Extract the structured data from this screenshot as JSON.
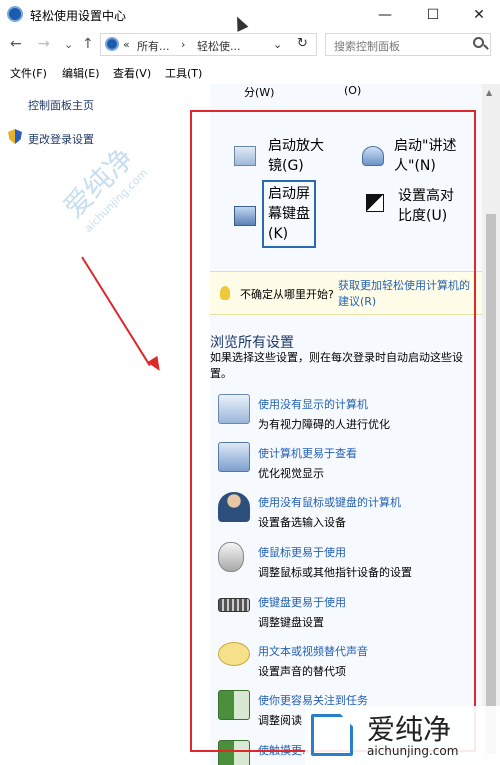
{
  "window": {
    "title": "轻松使用设置中心",
    "minimize": "—",
    "maximize": "☐",
    "close": "✕"
  },
  "nav": {
    "back": "←",
    "forward": "→",
    "recent": "⌄",
    "up": "↑",
    "breadcrumb_prefix": "«",
    "breadcrumb_1": "所有...",
    "breadcrumb_sep": "›",
    "breadcrumb_2": "轻松使...",
    "dropdown": "⌄",
    "refresh": "↻",
    "search_placeholder": "搜索控制面板"
  },
  "menu": [
    "文件(F)",
    "编辑(E)",
    "查看(V)",
    "工具(T)"
  ],
  "left": {
    "home_link": "控制面板主页",
    "login_link": "更改登录设置"
  },
  "right": {
    "top_row": [
      "分(W)",
      "(O)"
    ],
    "tools": [
      {
        "label_line1": "启动放大",
        "label_line2": "镜(G)",
        "icon": "magnifier-icon"
      },
      {
        "label_line1": "启动\"讲述",
        "label_line2": "人\"(N)",
        "icon": "narrator-icon"
      },
      {
        "label_line1": "启动屏",
        "label_line2": "幕键盘",
        "label_line3": "(K)",
        "icon": "onscreen-keyboard-icon"
      },
      {
        "label_line1": "设置高对",
        "label_line2": "比度(U)",
        "icon": "high-contrast-icon"
      }
    ],
    "tip": {
      "text": "不确定从哪里开始?",
      "link": "获取更加轻松使用计算机的建议(R)"
    },
    "section": {
      "title": "浏览所有设置",
      "desc": "如果选择这些设置，则在每次登录时自动启动这些设置。"
    },
    "settings": [
      {
        "link": "使用没有显示的计算机",
        "sub": "为有视力障碍的人进行优化",
        "icon": "monitor-icon"
      },
      {
        "link": "使计算机更易于查看",
        "sub": "优化视觉显示",
        "icon": "magnify-screen-icon"
      },
      {
        "link": "使用没有鼠标或键盘的计算机",
        "sub": "设置备选输入设备",
        "icon": "person-icon"
      },
      {
        "link": "使鼠标更易于使用",
        "sub": "调整鼠标或其他指针设备的设置",
        "icon": "mouse-icon"
      },
      {
        "link": "使键盘更易于使用",
        "sub": "调整键盘设置",
        "icon": "keyboard-icon"
      },
      {
        "link": "用文本或视频替代声音",
        "sub": "设置声音的替代项",
        "icon": "speech-bubble-icon"
      },
      {
        "link": "使你更容易关注到任务",
        "sub": "调整阅读",
        "icon": "focus-icon"
      },
      {
        "link": "使触摸更...",
        "sub": "",
        "icon": "touch-icon"
      }
    ]
  },
  "watermark": {
    "diag_text": "爱纯净",
    "diag_sub": "aichunjing.com",
    "corner_text": "爱纯净",
    "corner_sub": "aichunjing.com"
  },
  "colors": {
    "link": "#2461b5",
    "annotation": "#e0282a",
    "pane_bg": "#f6f9fd"
  }
}
